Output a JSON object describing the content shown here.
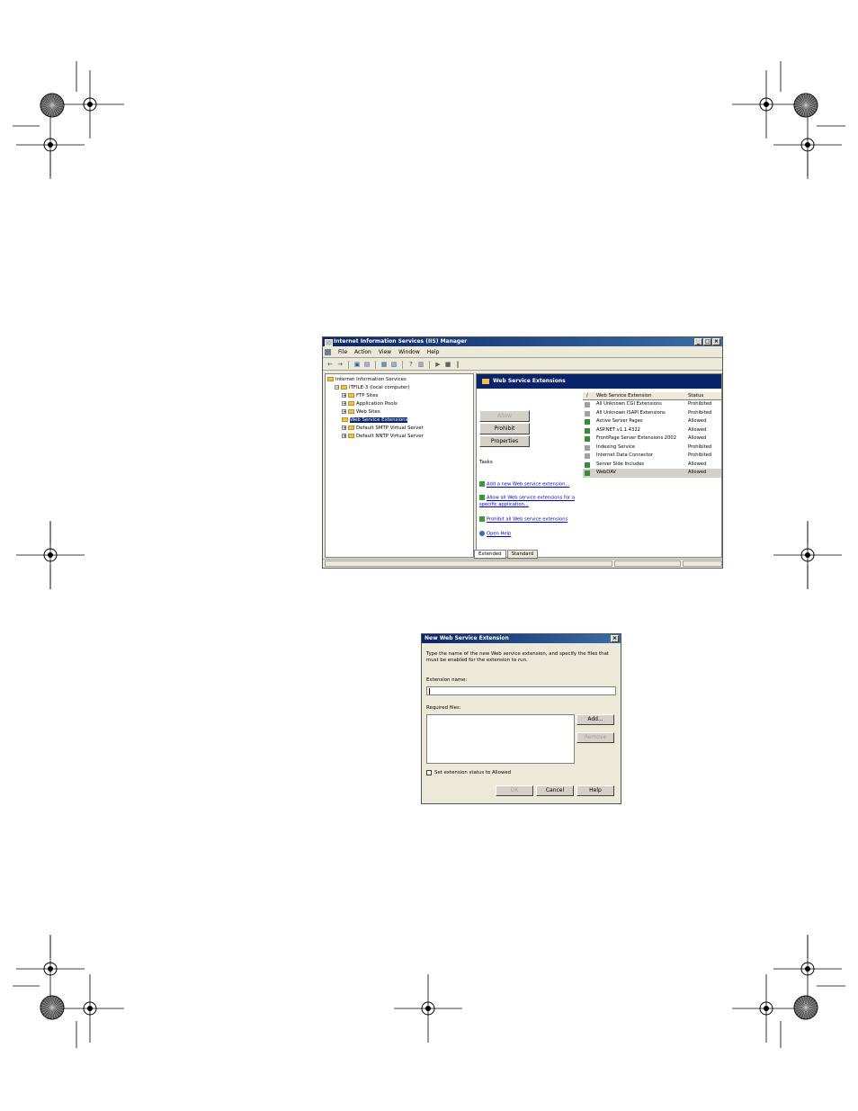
{
  "iis_window": {
    "title": "Internet Information Services (IIS) Manager",
    "menus": [
      "File",
      "Action",
      "View",
      "Window",
      "Help"
    ],
    "tree": [
      {
        "label": "Internet Information Services",
        "level": 0,
        "expander": ""
      },
      {
        "label": "ITFILE-3 (local computer)",
        "level": 1,
        "expander": "−"
      },
      {
        "label": "FTP Sites",
        "level": 2,
        "expander": "+"
      },
      {
        "label": "Application Pools",
        "level": 2,
        "expander": "+"
      },
      {
        "label": "Web Sites",
        "level": 2,
        "expander": "+"
      },
      {
        "label": "Web Service Extensions",
        "level": 2,
        "expander": "",
        "selected": true
      },
      {
        "label": "Default SMTP Virtual Server",
        "level": 2,
        "expander": "+"
      },
      {
        "label": "Default NNTP Virtual Server",
        "level": 2,
        "expander": "+"
      }
    ],
    "pane_title": "Web Service Extensions",
    "buttons": {
      "allow": "Allow",
      "prohibit": "Prohibit",
      "properties": "Properties"
    },
    "tasks_label": "Tasks",
    "tasks": [
      "Add a new Web service extension...",
      "Allow all Web service extensions for a",
      "specific application...",
      "Prohibit all Web service extensions",
      "Open Help"
    ],
    "list_headers": {
      "name": "Web Service Extension",
      "status": "Status"
    },
    "extensions": [
      {
        "name": "All Unknown CGI Extensions",
        "status": "Prohibited"
      },
      {
        "name": "All Unknown ISAPI Extensions",
        "status": "Prohibited"
      },
      {
        "name": "Active Server Pages",
        "status": "Allowed"
      },
      {
        "name": "ASP.NET v1.1.4322",
        "status": "Allowed"
      },
      {
        "name": "FrontPage Server Extensions 2002",
        "status": "Allowed"
      },
      {
        "name": "Indexing Service",
        "status": "Prohibited"
      },
      {
        "name": "Internet Data Connector",
        "status": "Prohibited"
      },
      {
        "name": "Server Side Includes",
        "status": "Allowed"
      },
      {
        "name": "WebDAV",
        "status": "Allowed"
      }
    ],
    "tabs": {
      "extended": "Extended",
      "standard": "Standard"
    }
  },
  "dialog": {
    "title": "New Web Service Extension",
    "instructions_1": "Type the name of the new Web service extension, and specify the files that",
    "instructions_2": "must be enabled for the extension to run.",
    "extension_name_label": "Extension name:",
    "extension_name_value": "",
    "required_files_label": "Required files:",
    "add_button": "Add...",
    "remove_button": "Remove",
    "checkbox_label": "Set extension status to Allowed",
    "ok_button": "OK",
    "cancel_button": "Cancel",
    "help_button": "Help"
  },
  "colors": {
    "titlebar": "#0a246a",
    "window_bg": "#ece9d8",
    "link": "#0000cc"
  }
}
